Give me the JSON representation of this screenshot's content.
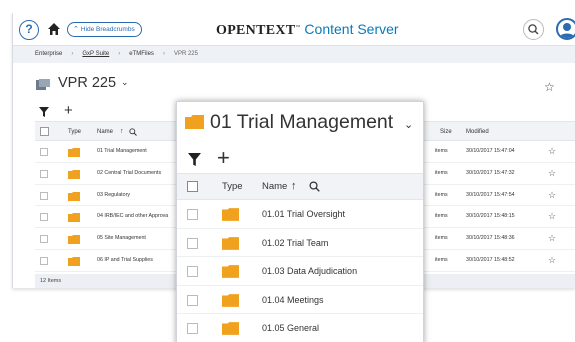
{
  "topbar": {
    "help_label": "?",
    "hide_breadcrumbs_label": "Hide Breadcrumbs",
    "brand_primary": "OPENTEXT",
    "brand_secondary": "Content Server"
  },
  "breadcrumb": [
    "Enterprise",
    "GxP Suite",
    "eTMFiles",
    "VPR 225"
  ],
  "page": {
    "title": "VPR 225"
  },
  "table": {
    "headers": {
      "type": "Type",
      "name": "Name",
      "size": "Size",
      "modified": "Modified"
    },
    "rows": [
      {
        "name": "01 Trial Management",
        "size": "items",
        "modified": "30/10/2017 15:47:04"
      },
      {
        "name": "02 Central Trial Documents",
        "size": "items",
        "modified": "30/10/2017 15:47:32"
      },
      {
        "name": "03 Regulatory",
        "size": "items",
        "modified": "30/10/2017 15:47:54"
      },
      {
        "name": "04 IRB/IEC and other Approva",
        "size": "items",
        "modified": "30/10/2017 15:48:15"
      },
      {
        "name": "05 Site Management",
        "size": "items",
        "modified": "30/10/2017 15:48:36"
      },
      {
        "name": "06 IP and Trial Supplies",
        "size": "items",
        "modified": "30/10/2017 15:48:52"
      }
    ],
    "footer": "12 Items"
  },
  "zoom": {
    "title": "01 Trial Management",
    "headers": {
      "type": "Type",
      "name": "Name"
    },
    "rows": [
      {
        "name": "01.01 Trial Oversight"
      },
      {
        "name": "01.02 Trial Team"
      },
      {
        "name": "01.03 Data Adjudication"
      },
      {
        "name": "01.04 Meetings"
      },
      {
        "name": "01.05 General"
      }
    ]
  },
  "icons": {
    "folder_color": "#f0a21e",
    "accent": "#2b6cb0",
    "brand_blue": "#0a7ab8"
  }
}
